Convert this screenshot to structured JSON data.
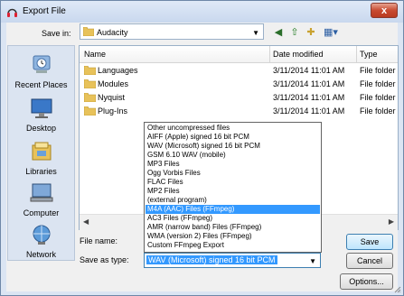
{
  "window": {
    "title": "Export File",
    "close_label": "x"
  },
  "save_in": {
    "label": "Save in:",
    "value": "Audacity"
  },
  "places": [
    {
      "label": "Recent Places",
      "icon": "recent-places-icon"
    },
    {
      "label": "Desktop",
      "icon": "desktop-icon"
    },
    {
      "label": "Libraries",
      "icon": "libraries-icon"
    },
    {
      "label": "Computer",
      "icon": "computer-icon"
    },
    {
      "label": "Network",
      "icon": "network-icon"
    }
  ],
  "columns": {
    "name": "Name",
    "date": "Date modified",
    "type": "Type"
  },
  "files": [
    {
      "name": "Languages",
      "date": "3/11/2014 11:01 AM",
      "type": "File folder"
    },
    {
      "name": "Modules",
      "date": "3/11/2014 11:01 AM",
      "type": "File folder"
    },
    {
      "name": "Nyquist",
      "date": "3/11/2014 11:01 AM",
      "type": "File folder"
    },
    {
      "name": "Plug-Ins",
      "date": "3/11/2014 11:01 AM",
      "type": "File folder"
    }
  ],
  "file_name": {
    "label": "File name:",
    "value": ""
  },
  "save_as_type": {
    "label": "Save as type:",
    "value": "WAV (Microsoft) signed 16 bit PCM",
    "options": [
      "Other uncompressed files",
      "AIFF (Apple) signed 16 bit PCM",
      "WAV (Microsoft) signed 16 bit PCM",
      "GSM 6.10 WAV (mobile)",
      "MP3 Files",
      "Ogg Vorbis Files",
      "FLAC Files",
      "MP2 Files",
      "(external program)",
      "M4A (AAC) Files (FFmpeg)",
      "AC3 Files (FFmpeg)",
      "AMR (narrow band) Files (FFmpeg)",
      "WMA (version 2) Files (FFmpeg)",
      "Custom FFmpeg Export"
    ],
    "highlighted_index": 9
  },
  "buttons": {
    "save": "Save",
    "cancel": "Cancel",
    "options": "Options..."
  },
  "toolbar": {
    "back": "◀",
    "up": "⇧",
    "new_folder": "✚",
    "views": "▦▾"
  },
  "colors": {
    "selection": "#3399ff",
    "folder": "#e8c25a"
  }
}
